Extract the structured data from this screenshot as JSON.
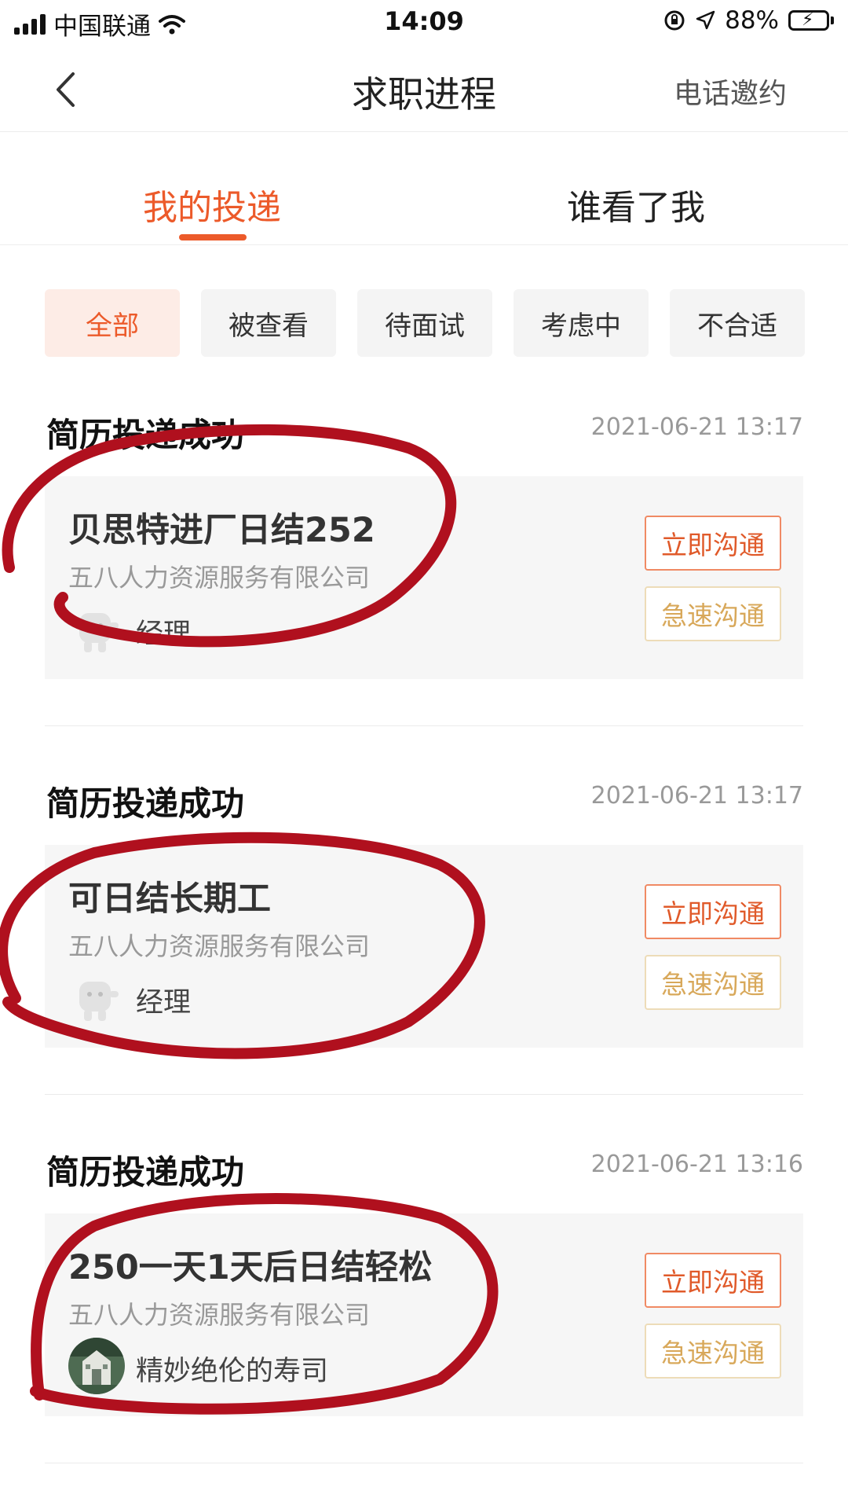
{
  "status_bar": {
    "carrier": "中国联通",
    "time": "14:09",
    "battery": "88%",
    "battery_level": 0.88,
    "icons": [
      "signal-icon",
      "wifi-icon",
      "orientation-lock-icon",
      "location-arrow-icon",
      "battery-charging-icon"
    ]
  },
  "nav": {
    "title": "求职进程",
    "right_action": "电话邀约",
    "back_icon": "chevron-left-icon"
  },
  "tabs": [
    {
      "label": "我的投递",
      "active": true
    },
    {
      "label": "谁看了我",
      "active": false
    }
  ],
  "filters": [
    {
      "label": "全部",
      "active": true
    },
    {
      "label": "被查看",
      "active": false
    },
    {
      "label": "待面试",
      "active": false
    },
    {
      "label": "考虑中",
      "active": false
    },
    {
      "label": "不合适",
      "active": false
    }
  ],
  "applications": [
    {
      "status": "简历投递成功",
      "time": "2021-06-21 13:17",
      "job_title": "贝思特进厂日结252",
      "company": "五八人力资源服务有限公司",
      "recruiter": "经理",
      "chat_button": "立即沟通",
      "fast_button": "急速沟通"
    },
    {
      "status": "简历投递成功",
      "time": "2021-06-21 13:17",
      "job_title": "可日结长期工",
      "company": "五八人力资源服务有限公司",
      "recruiter": "经理",
      "chat_button": "立即沟通",
      "fast_button": "急速沟通"
    },
    {
      "status": "简历投递成功",
      "time": "2021-06-21 13:16",
      "job_title": "250一天1天后日结轻松",
      "company": "五八人力资源服务有限公司",
      "recruiter": "精妙绝伦的寿司",
      "chat_button": "立即沟通",
      "fast_button": "急速沟通"
    }
  ],
  "colors": {
    "accent": "#ec5a2a",
    "accent_bg": "#fdece6",
    "fast_button_text": "#d8a85a",
    "annotation_red": "#b0101e"
  }
}
